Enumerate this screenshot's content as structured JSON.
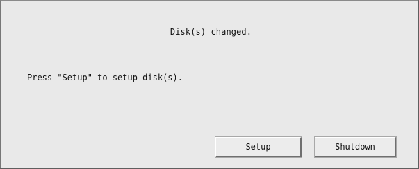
{
  "dialog": {
    "title": "Disk(s) changed.",
    "message": "Press \"Setup\" to setup disk(s)."
  },
  "buttons": {
    "setup": "Setup",
    "shutdown": "Shutdown"
  }
}
